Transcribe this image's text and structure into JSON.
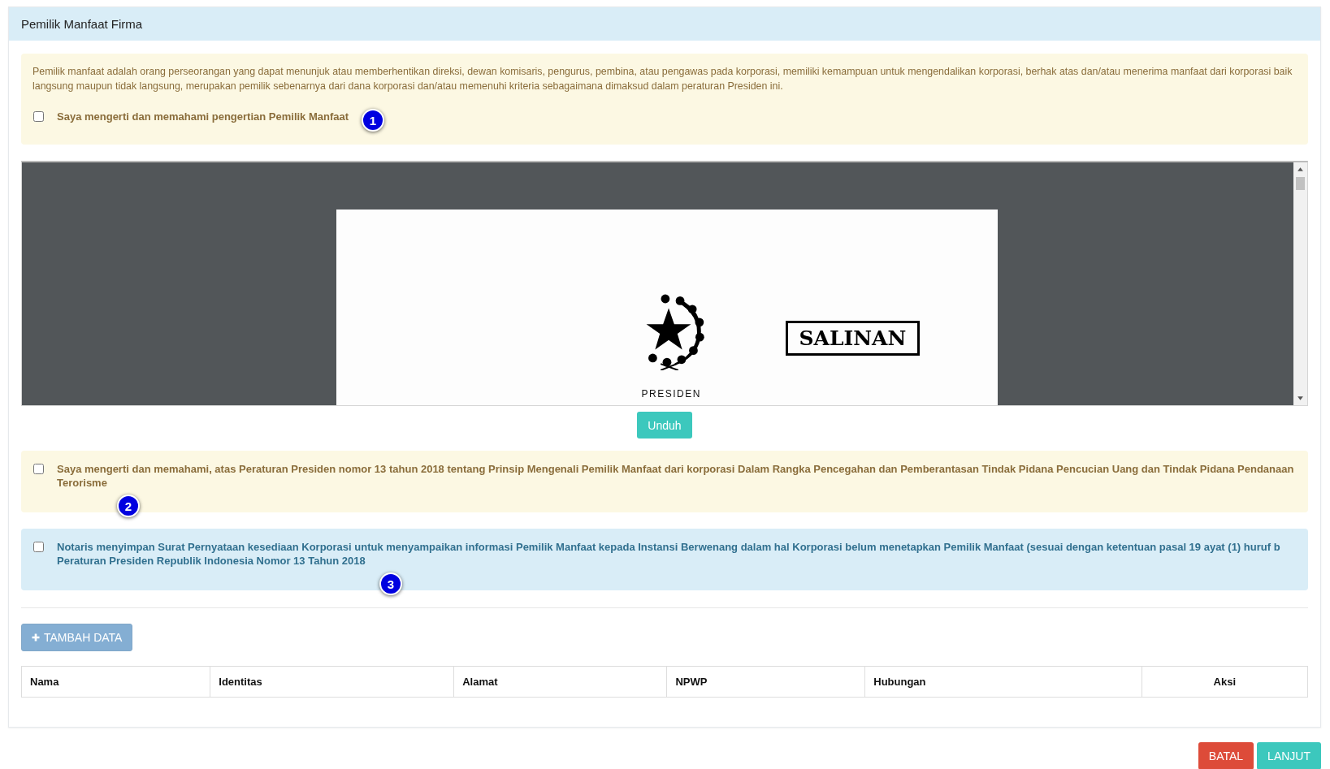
{
  "panel": {
    "title": "Pemilik Manfaat Firma"
  },
  "intro": {
    "kind": "warning",
    "text": "Pemilik manfaat adalah orang perseorangan yang dapat menunjuk atau memberhentikan direksi, dewan komisaris, pengurus, pembina, atau pengawas pada korporasi, memiliki kemampuan untuk mengendalikan korporasi, berhak atas dan/atau menerima manfaat dari korporasi baik langsung maupun tidak langsung, merupakan pemilik sebenarnya dari dana korporasi dan/atau memenuhi kriteria sebagaimana dimaksud dalam peraturan Presiden ini.",
    "label": "Saya mengerti dan memahami pengertian Pemilik Manfaat",
    "checked": false,
    "badge": "1"
  },
  "document": {
    "stamp": "SALINAN",
    "caption": "PRESIDEN",
    "download_button": "Unduh"
  },
  "statements": [
    {
      "kind": "warning",
      "label": "Saya mengerti dan memahami, atas Peraturan Presiden nomor 13 tahun 2018 tentang Prinsip Mengenali Pemilik Manfaat dari korporasi Dalam Rangka Pencegahan dan Pemberantasan Tindak Pidana Pencucian Uang dan Tindak Pidana Pendanaan Terorisme",
      "checked": false,
      "badge": "2"
    },
    {
      "kind": "info",
      "label": "Notaris menyimpan Surat Pernyataan kesediaan Korporasi untuk menyampaikan informasi Pemilik Manfaat kepada Instansi Berwenang dalam hal Korporasi belum menetapkan Pemilik Manfaat (sesuai dengan ketentuan pasal 19 ayat (1) huruf b Peraturan Presiden Republik Indonesia Nomor 13 Tahun 2018",
      "checked": false,
      "badge": "3"
    }
  ],
  "add_button": {
    "label": "TAMBAH DATA",
    "disabled": true
  },
  "table": {
    "columns": [
      "Nama",
      "Identitas",
      "Alamat",
      "NPWP",
      "Hubungan",
      "Aksi"
    ]
  },
  "footer_buttons": [
    {
      "kind": "danger",
      "label": "BATAL"
    },
    {
      "kind": "primary",
      "label": "LANJUT"
    }
  ]
}
